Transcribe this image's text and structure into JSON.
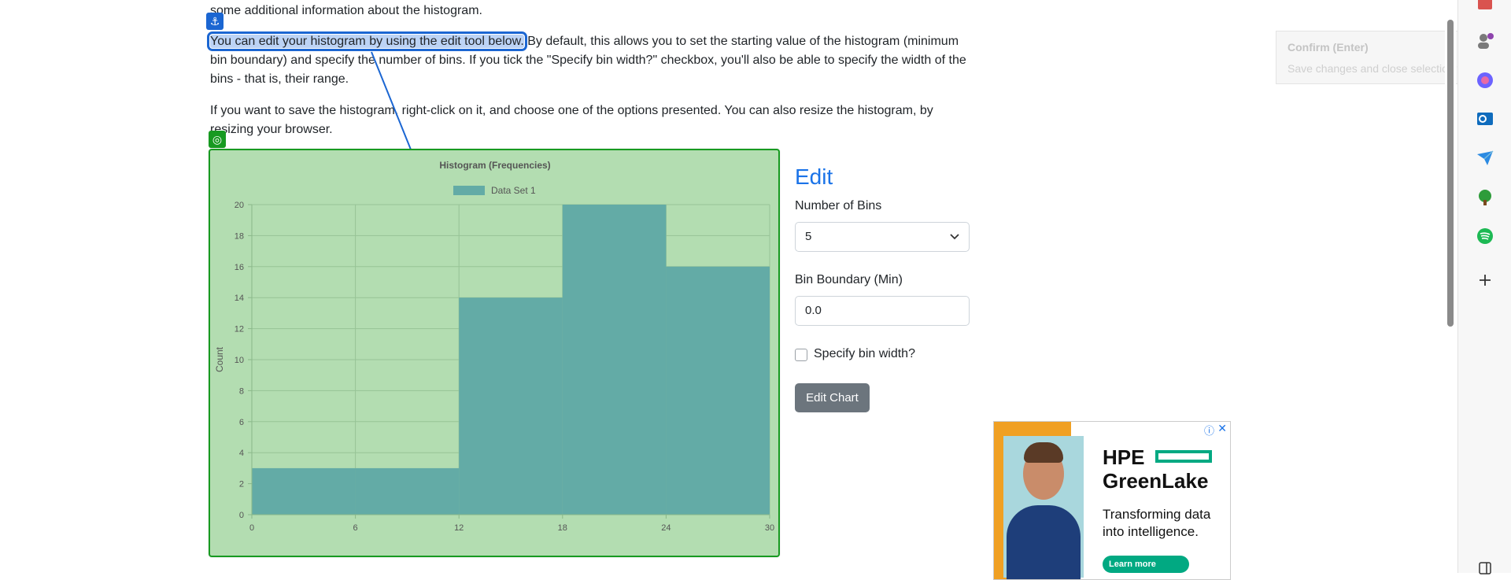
{
  "article": {
    "line_top": "some additional information about the histogram.",
    "highlight": "You can edit your histogram by using the edit tool below.",
    "para1_rest_line1": " By default, this allows you to set the starting value of the histogram (minimum",
    "para1_line2": "bin boundary) and specify the number of bins. If you tick the \"Specify bin width?\" checkbox, you'll also be able to specify the width of the",
    "para1_line3": "bins - that is, their range.",
    "para2_line1": "If you want to save the histogram, right-click on it, and choose one of the options presented. You can also resize the histogram, by",
    "para2_line2": "resizing your browser."
  },
  "edit_panel": {
    "title": "Edit",
    "bins_label": "Number of Bins",
    "bins_value": "5",
    "boundary_label": "Bin Boundary (Min)",
    "boundary_value": "0.0",
    "checkbox_label": "Specify bin width?",
    "button_label": "Edit Chart"
  },
  "tooltip": {
    "title": "Confirm (Enter)",
    "subtitle": "Save changes and close selection wizard."
  },
  "ad": {
    "brand_line1": "HPE",
    "brand_line2": "GreenLake",
    "tagline": "Transforming data into intelligence.",
    "cta": "Learn more",
    "info": "ⓘ",
    "close": "✕"
  },
  "icons": {
    "anchor": "⚓",
    "target": "◎"
  },
  "colors": {
    "bar_fill": "#63aba6",
    "panel_bg": "#b3ddb1",
    "panel_border": "#179a21",
    "highlight_border": "#1b66d2",
    "accent": "#1a73e8"
  },
  "chart_data": {
    "type": "bar",
    "title": "Histogram (Frequencies)",
    "xlabel": "",
    "ylabel": "Count",
    "legend": "top",
    "grid": true,
    "ylim": [
      0,
      20
    ],
    "xlim": [
      0,
      30
    ],
    "x_ticks": [
      "0",
      "6",
      "12",
      "18",
      "24",
      "30"
    ],
    "y_ticks": [
      "0",
      "2",
      "4",
      "6",
      "8",
      "10",
      "12",
      "14",
      "16",
      "18",
      "20"
    ],
    "series": [
      {
        "name": "Data Set 1",
        "bins": [
          [
            0,
            6
          ],
          [
            6,
            12
          ],
          [
            12,
            18
          ],
          [
            18,
            24
          ],
          [
            24,
            30
          ]
        ],
        "values": [
          3,
          3,
          14,
          20,
          16
        ]
      }
    ]
  }
}
